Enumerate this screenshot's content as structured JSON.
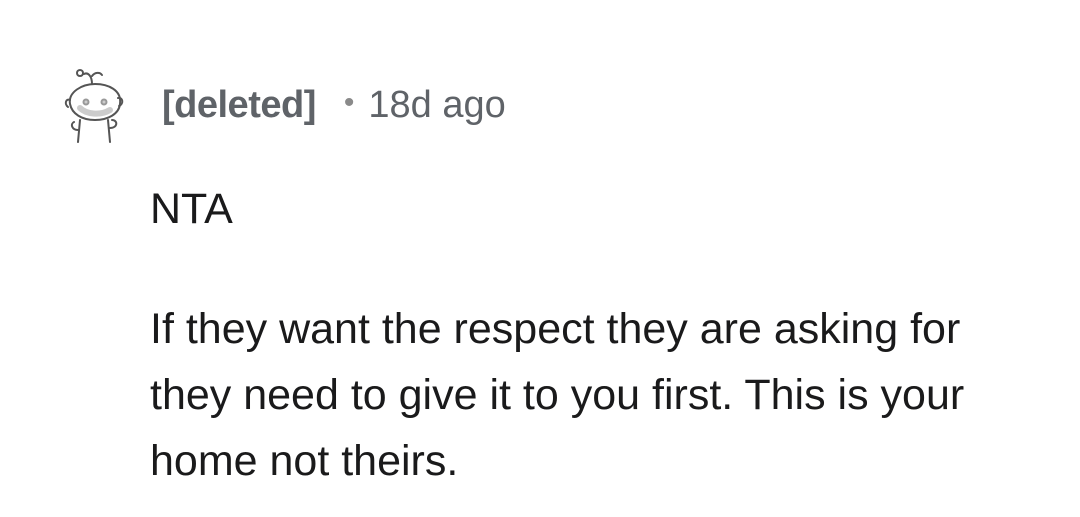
{
  "comment": {
    "author": "[deleted]",
    "separator": "•",
    "timestamp": "18d ago",
    "avatar_icon": "deleted-user-snoo-icon",
    "paragraphs": [
      "NTA",
      "If they want the respect they are asking for they need to give it to you first. This is your home not theirs."
    ]
  },
  "colors": {
    "meta_text": "#5f6368",
    "body_text": "#1a1a1b",
    "background": "#ffffff"
  }
}
